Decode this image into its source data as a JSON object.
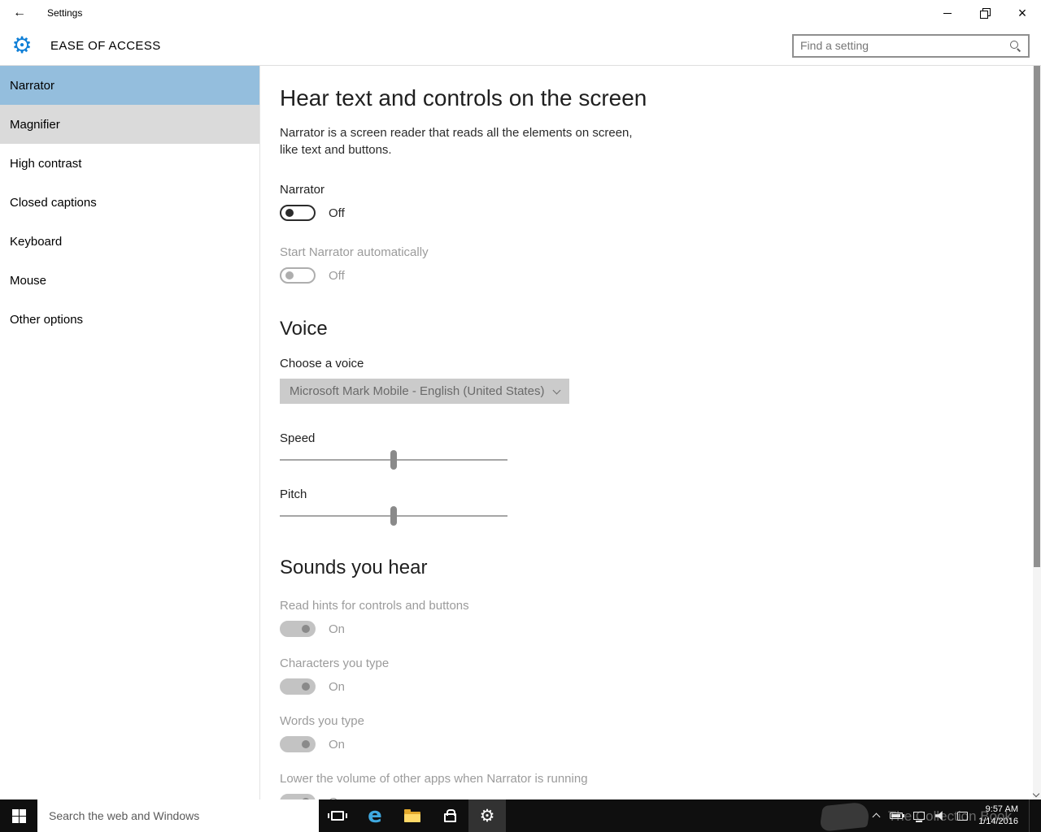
{
  "icons": {
    "back": "←",
    "gear": "⚙",
    "close": "×",
    "edge": "e"
  },
  "titlebar": {
    "title": "Settings"
  },
  "header": {
    "title": "EASE OF ACCESS"
  },
  "search": {
    "placeholder": "Find a setting"
  },
  "sidebar": {
    "items": [
      {
        "label": "Narrator",
        "state": "selected"
      },
      {
        "label": "Magnifier",
        "state": "hover"
      },
      {
        "label": "High contrast",
        "state": "normal"
      },
      {
        "label": "Closed captions",
        "state": "normal"
      },
      {
        "label": "Keyboard",
        "state": "normal"
      },
      {
        "label": "Mouse",
        "state": "normal"
      },
      {
        "label": "Other options",
        "state": "normal"
      }
    ]
  },
  "content": {
    "heading": "Hear text and controls on the screen",
    "description": "Narrator is a screen reader that reads all the elements on screen, like text and buttons.",
    "narrator_toggle": {
      "label": "Narrator",
      "value": "Off",
      "enabled": true
    },
    "start_auto_toggle": {
      "label": "Start Narrator automatically",
      "value": "Off",
      "enabled": false
    },
    "voice_heading": "Voice",
    "choose_voice_label": "Choose a voice",
    "voice_dropdown_value": "Microsoft Mark Mobile - English (United States)",
    "speed_label": "Speed",
    "pitch_label": "Pitch",
    "speed_value_percent": 50,
    "pitch_value_percent": 50,
    "sounds_heading": "Sounds you hear",
    "sound_toggles": [
      {
        "label": "Read hints for controls and buttons",
        "value": "On"
      },
      {
        "label": "Characters you type",
        "value": "On"
      },
      {
        "label": "Words you type",
        "value": "On"
      },
      {
        "label": "Lower the volume of other apps when Narrator is running",
        "value": "On"
      }
    ]
  },
  "taskbar": {
    "search_placeholder": "Search the web and Windows",
    "clock": {
      "time": "9:57 AM",
      "date": "1/14/2016"
    },
    "watermark": "The Collection Book"
  },
  "colors": {
    "sidebar_selected": "#94bedd",
    "sidebar_hover": "#dadada",
    "taskbar_bg": "#0f0f0f",
    "gear_blue": "#0f7fd7",
    "edge_blue": "#3fa9e0",
    "folder_yellow": "#ffd968"
  }
}
